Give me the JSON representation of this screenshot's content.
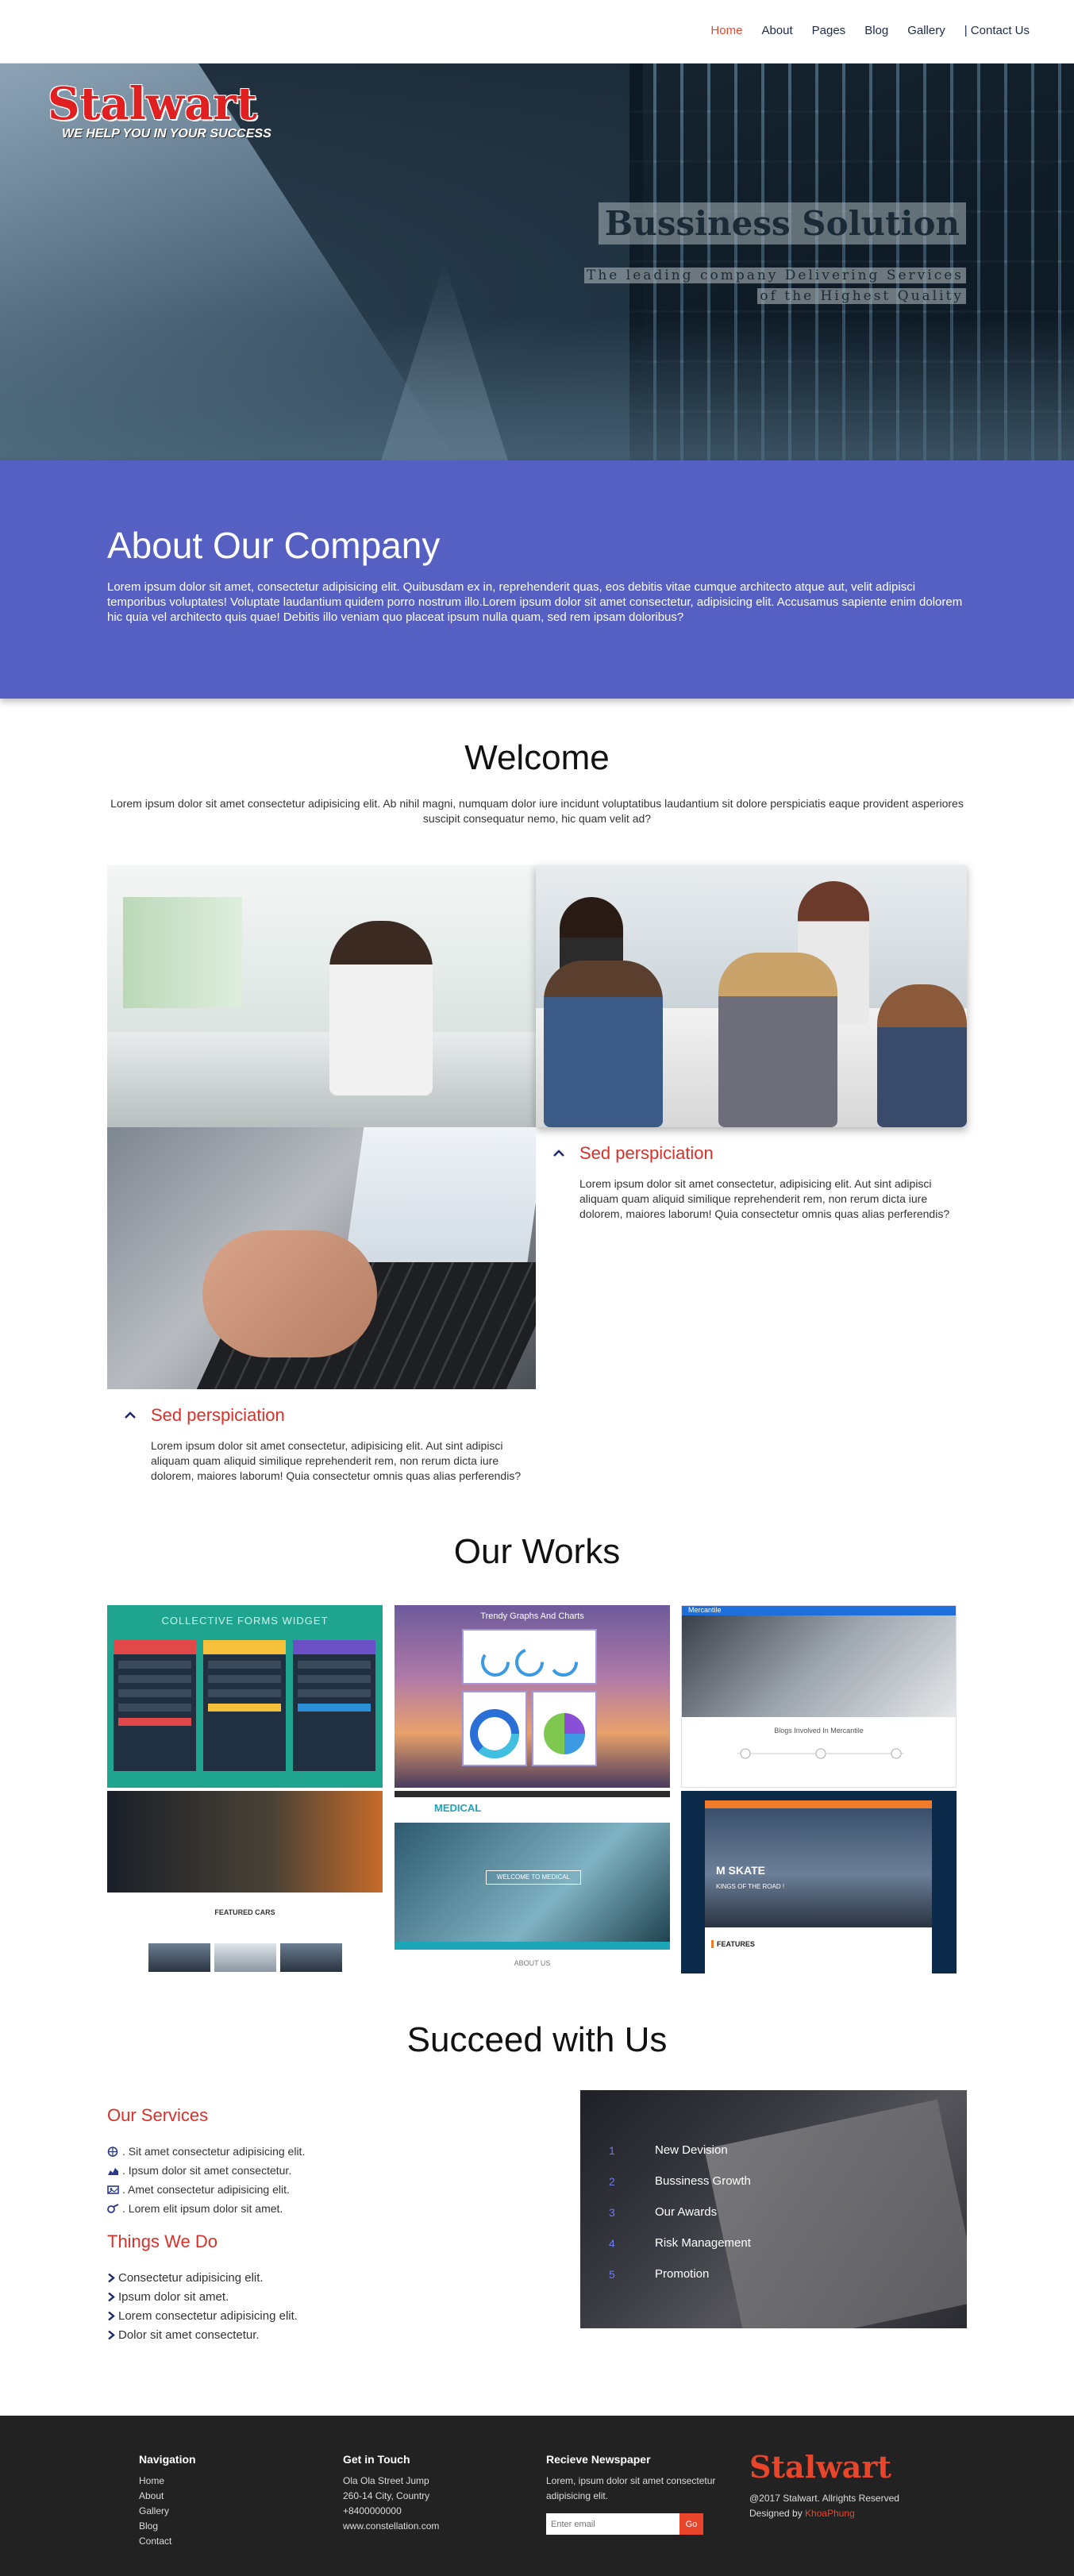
{
  "nav": {
    "items": [
      {
        "label": "Home",
        "active": true
      },
      {
        "label": "About"
      },
      {
        "label": "Pages"
      },
      {
        "label": "Blog"
      },
      {
        "label": "Gallery"
      },
      {
        "label": "| Contact Us"
      }
    ]
  },
  "brand": {
    "name": "Stalwart",
    "tagline": "WE HELP YOU IN YOUR SUCCESS",
    "color": "#e02020"
  },
  "hero": {
    "title": "Bussiness Solution",
    "subtitle_line1": "The leading company Delivering Services",
    "subtitle_line2": "of the Highest Quality"
  },
  "about": {
    "title": "About Our Company",
    "text": "Lorem ipsum dolor sit amet, consectetur adipisicing elit. Quibusdam ex in, reprehenderit quas, eos debitis vitae cumque architecto atque aut, velit adipisci temporibus voluptates! Voluptate laudantium quidem porro nostrum illo.Lorem ipsum dolor sit amet consectetur, adipisicing elit. Accusamus sapiente enim dolorem hic quia vel architecto quis quae! Debitis illo veniam quo placeat ipsum nulla quam, sed rem ipsam doloribus?",
    "bg_color": "#5560c2"
  },
  "welcome": {
    "title": "Welcome",
    "text": "Lorem ipsum dolor sit amet consectetur adipisicing elit. Ab nihil magni, numquam dolor iure incidunt voluptatibus laudantium sit dolore perspiciatis eaque provident asperiores suscipit consequatur nemo, hic quam velit ad?",
    "features": [
      {
        "title": "Sed perspiciation",
        "text": "Lorem ipsum dolor sit amet consectetur, adipisicing elit. Aut sint adipisci aliquam quam aliquid similique reprehenderit rem, non rerum dicta iure dolorem, maiores laborum! Quia consectetur omnis quas alias perferendis?"
      },
      {
        "title": "Sed perspiciation",
        "text": "Lorem ipsum dolor sit amet consectetur, adipisicing elit. Aut sint adipisci aliquam quam aliquid similique reprehenderit rem, non rerum dicta iure dolorem, maiores laborum! Quia consectetur omnis quas alias perferendis?"
      }
    ]
  },
  "works": {
    "title": "Our Works",
    "items": [
      {
        "title": "COLLECTIVE FORMS WIDGET"
      },
      {
        "title": "Trendy Graphs And Charts"
      },
      {
        "title": "Mercantile",
        "subtitle": "Blogs Involved In Mercantile"
      },
      {
        "subtitle": "FEATURED CARS"
      },
      {
        "title": "MEDICAL",
        "button": "WELCOME TO MEDICAL",
        "subtitle": "ABOUT US"
      },
      {
        "title": "M SKATE",
        "subtitle": "KINGS OF THE ROAD !",
        "feature": "FEATURES"
      }
    ]
  },
  "succeed": {
    "title": "Succeed with Us",
    "services_title": "Our Services",
    "services": [
      {
        "icon": "globe-icon",
        "text": ". Sit amet consectetur adipisicing elit."
      },
      {
        "icon": "area-chart-icon",
        "text": ". Ipsum dolor sit amet consectetur."
      },
      {
        "icon": "image-icon",
        "text": ". Amet consectetur adipisicing elit."
      },
      {
        "icon": "tools-icon",
        "text": ". Lorem elit ipsum dolor sit amet."
      }
    ],
    "things_title": "Things We Do",
    "things": [
      {
        "text": "Consectetur adipisicing elit."
      },
      {
        "text": "Ipsum dolor sit amet."
      },
      {
        "text": "Lorem consectetur adipisicing elit."
      },
      {
        "text": "Dolor sit amet consectetur."
      }
    ],
    "numbered": [
      {
        "num": "1",
        "label": "New Devision"
      },
      {
        "num": "2",
        "label": "Bussiness Growth"
      },
      {
        "num": "3",
        "label": "Our Awards"
      },
      {
        "num": "4",
        "label": "Risk Management"
      },
      {
        "num": "5",
        "label": "Promotion"
      }
    ]
  },
  "footer": {
    "nav_title": "Navigation",
    "nav_items": [
      {
        "label": "Home"
      },
      {
        "label": "About"
      },
      {
        "label": "Gallery"
      },
      {
        "label": "Blog"
      },
      {
        "label": "Contact"
      }
    ],
    "contact_title": "Get in Touch",
    "contact_lines": [
      {
        "text": "Ola Ola Street Jump"
      },
      {
        "text": "260-14 City, Country"
      },
      {
        "text": "+8400000000"
      },
      {
        "text": "www.constellation.com"
      }
    ],
    "news_title": "Recieve Newspaper",
    "news_text": "Lorem, ipsum dolor sit amet consectetur adipisicing elit.",
    "email_placeholder": "Enter email",
    "go_label": "Go",
    "logo": "Stalwart",
    "copyright": "@2017 Stalwart. Allrights Reserved",
    "designed_by": "Designed by ",
    "designer": "KhoaPhung",
    "accent": "#e8452a"
  }
}
